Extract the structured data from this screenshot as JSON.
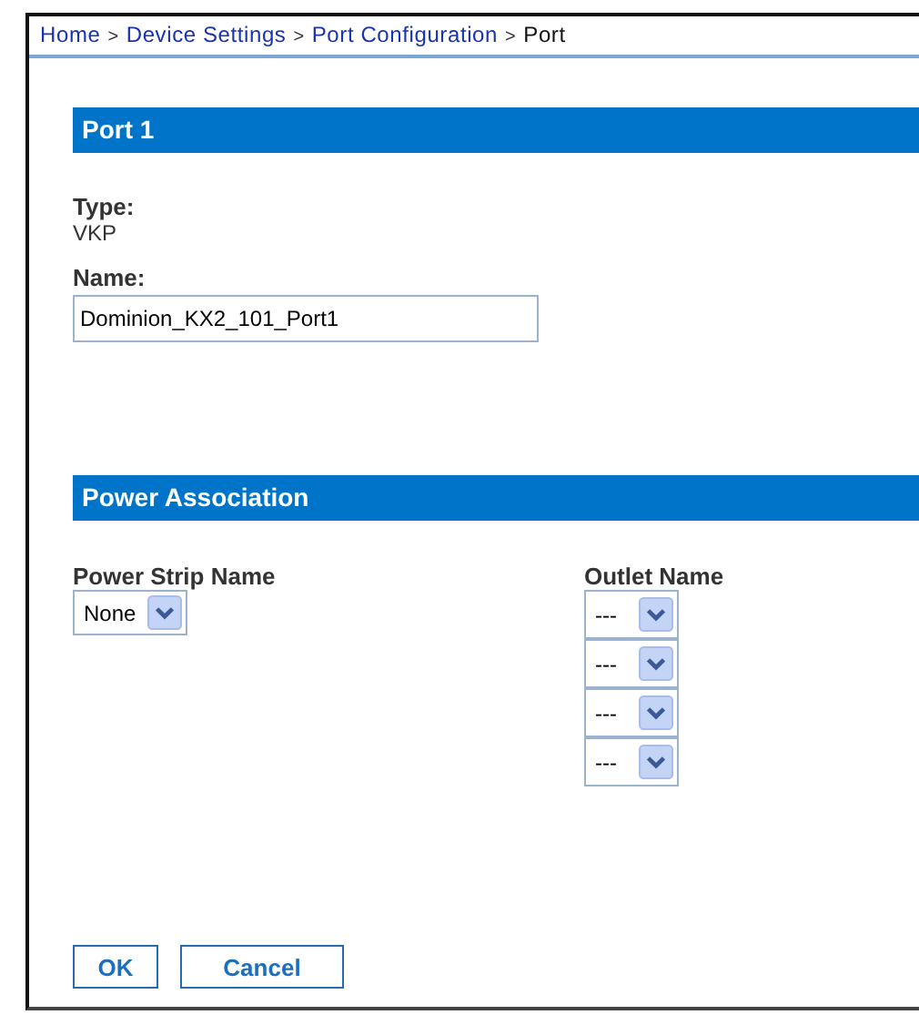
{
  "breadcrumb": {
    "separator": ">",
    "items": [
      {
        "label": "Home",
        "link": true
      },
      {
        "label": "Device Settings",
        "link": true
      },
      {
        "label": "Port Configuration",
        "link": true
      },
      {
        "label": "Port",
        "link": false
      }
    ]
  },
  "port_section": {
    "title": "Port 1",
    "type_label": "Type:",
    "type_value": "VKP",
    "name_label": "Name:",
    "name_value": "Dominion_KX2_101_Port1"
  },
  "power_section": {
    "title": "Power Association",
    "strip_label": "Power Strip Name",
    "strip_value": "None",
    "outlet_label": "Outlet Name",
    "outlets": [
      {
        "value": "---"
      },
      {
        "value": "---"
      },
      {
        "value": "---"
      },
      {
        "value": "---"
      }
    ]
  },
  "buttons": [
    "OK",
    "Cancel"
  ]
}
